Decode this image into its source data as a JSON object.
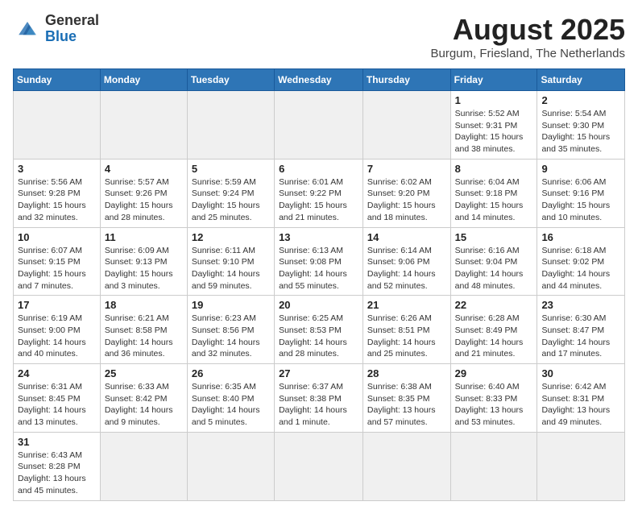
{
  "logo": {
    "text_general": "General",
    "text_blue": "Blue"
  },
  "header": {
    "month_year": "August 2025",
    "location": "Burgum, Friesland, The Netherlands"
  },
  "weekdays": [
    "Sunday",
    "Monday",
    "Tuesday",
    "Wednesday",
    "Thursday",
    "Friday",
    "Saturday"
  ],
  "weeks": [
    {
      "days": [
        {
          "number": "",
          "info": "",
          "empty": true
        },
        {
          "number": "",
          "info": "",
          "empty": true
        },
        {
          "number": "",
          "info": "",
          "empty": true
        },
        {
          "number": "",
          "info": "",
          "empty": true
        },
        {
          "number": "",
          "info": "",
          "empty": true
        },
        {
          "number": "1",
          "info": "Sunrise: 5:52 AM\nSunset: 9:31 PM\nDaylight: 15 hours and 38 minutes."
        },
        {
          "number": "2",
          "info": "Sunrise: 5:54 AM\nSunset: 9:30 PM\nDaylight: 15 hours and 35 minutes."
        }
      ]
    },
    {
      "days": [
        {
          "number": "3",
          "info": "Sunrise: 5:56 AM\nSunset: 9:28 PM\nDaylight: 15 hours and 32 minutes."
        },
        {
          "number": "4",
          "info": "Sunrise: 5:57 AM\nSunset: 9:26 PM\nDaylight: 15 hours and 28 minutes."
        },
        {
          "number": "5",
          "info": "Sunrise: 5:59 AM\nSunset: 9:24 PM\nDaylight: 15 hours and 25 minutes."
        },
        {
          "number": "6",
          "info": "Sunrise: 6:01 AM\nSunset: 9:22 PM\nDaylight: 15 hours and 21 minutes."
        },
        {
          "number": "7",
          "info": "Sunrise: 6:02 AM\nSunset: 9:20 PM\nDaylight: 15 hours and 18 minutes."
        },
        {
          "number": "8",
          "info": "Sunrise: 6:04 AM\nSunset: 9:18 PM\nDaylight: 15 hours and 14 minutes."
        },
        {
          "number": "9",
          "info": "Sunrise: 6:06 AM\nSunset: 9:16 PM\nDaylight: 15 hours and 10 minutes."
        }
      ]
    },
    {
      "days": [
        {
          "number": "10",
          "info": "Sunrise: 6:07 AM\nSunset: 9:15 PM\nDaylight: 15 hours and 7 minutes."
        },
        {
          "number": "11",
          "info": "Sunrise: 6:09 AM\nSunset: 9:13 PM\nDaylight: 15 hours and 3 minutes."
        },
        {
          "number": "12",
          "info": "Sunrise: 6:11 AM\nSunset: 9:10 PM\nDaylight: 14 hours and 59 minutes."
        },
        {
          "number": "13",
          "info": "Sunrise: 6:13 AM\nSunset: 9:08 PM\nDaylight: 14 hours and 55 minutes."
        },
        {
          "number": "14",
          "info": "Sunrise: 6:14 AM\nSunset: 9:06 PM\nDaylight: 14 hours and 52 minutes."
        },
        {
          "number": "15",
          "info": "Sunrise: 6:16 AM\nSunset: 9:04 PM\nDaylight: 14 hours and 48 minutes."
        },
        {
          "number": "16",
          "info": "Sunrise: 6:18 AM\nSunset: 9:02 PM\nDaylight: 14 hours and 44 minutes."
        }
      ]
    },
    {
      "days": [
        {
          "number": "17",
          "info": "Sunrise: 6:19 AM\nSunset: 9:00 PM\nDaylight: 14 hours and 40 minutes."
        },
        {
          "number": "18",
          "info": "Sunrise: 6:21 AM\nSunset: 8:58 PM\nDaylight: 14 hours and 36 minutes."
        },
        {
          "number": "19",
          "info": "Sunrise: 6:23 AM\nSunset: 8:56 PM\nDaylight: 14 hours and 32 minutes."
        },
        {
          "number": "20",
          "info": "Sunrise: 6:25 AM\nSunset: 8:53 PM\nDaylight: 14 hours and 28 minutes."
        },
        {
          "number": "21",
          "info": "Sunrise: 6:26 AM\nSunset: 8:51 PM\nDaylight: 14 hours and 25 minutes."
        },
        {
          "number": "22",
          "info": "Sunrise: 6:28 AM\nSunset: 8:49 PM\nDaylight: 14 hours and 21 minutes."
        },
        {
          "number": "23",
          "info": "Sunrise: 6:30 AM\nSunset: 8:47 PM\nDaylight: 14 hours and 17 minutes."
        }
      ]
    },
    {
      "days": [
        {
          "number": "24",
          "info": "Sunrise: 6:31 AM\nSunset: 8:45 PM\nDaylight: 14 hours and 13 minutes."
        },
        {
          "number": "25",
          "info": "Sunrise: 6:33 AM\nSunset: 8:42 PM\nDaylight: 14 hours and 9 minutes."
        },
        {
          "number": "26",
          "info": "Sunrise: 6:35 AM\nSunset: 8:40 PM\nDaylight: 14 hours and 5 minutes."
        },
        {
          "number": "27",
          "info": "Sunrise: 6:37 AM\nSunset: 8:38 PM\nDaylight: 14 hours and 1 minute."
        },
        {
          "number": "28",
          "info": "Sunrise: 6:38 AM\nSunset: 8:35 PM\nDaylight: 13 hours and 57 minutes."
        },
        {
          "number": "29",
          "info": "Sunrise: 6:40 AM\nSunset: 8:33 PM\nDaylight: 13 hours and 53 minutes."
        },
        {
          "number": "30",
          "info": "Sunrise: 6:42 AM\nSunset: 8:31 PM\nDaylight: 13 hours and 49 minutes."
        }
      ]
    },
    {
      "days": [
        {
          "number": "31",
          "info": "Sunrise: 6:43 AM\nSunset: 8:28 PM\nDaylight: 13 hours and 45 minutes."
        },
        {
          "number": "",
          "info": "",
          "empty": true
        },
        {
          "number": "",
          "info": "",
          "empty": true
        },
        {
          "number": "",
          "info": "",
          "empty": true
        },
        {
          "number": "",
          "info": "",
          "empty": true
        },
        {
          "number": "",
          "info": "",
          "empty": true
        },
        {
          "number": "",
          "info": "",
          "empty": true
        }
      ]
    }
  ]
}
